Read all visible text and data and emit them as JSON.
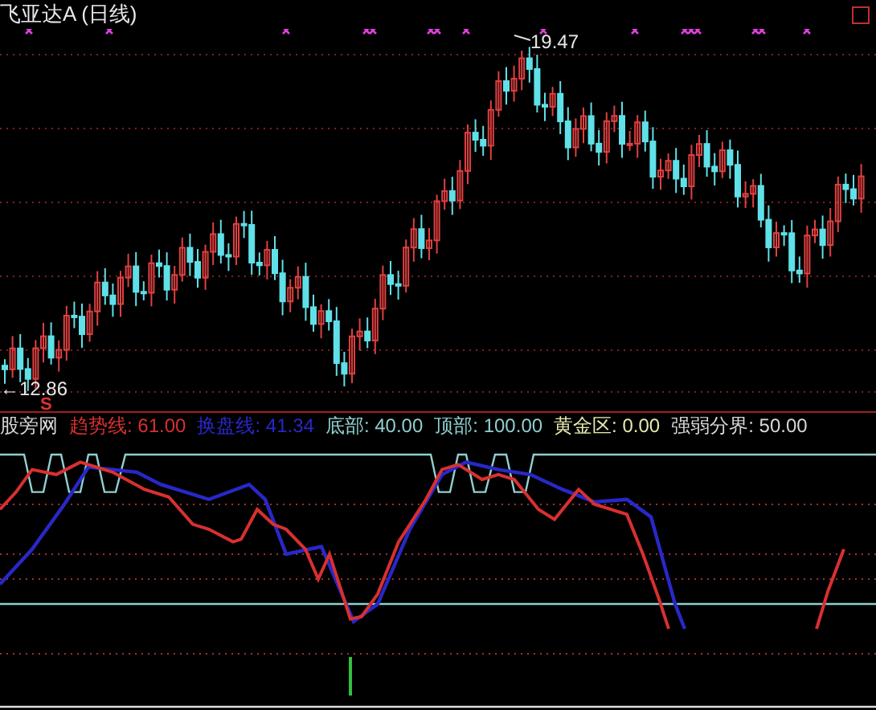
{
  "title": "飞亚达A (日线)",
  "price_chart": {
    "high_label": "19.47",
    "low_label": "←12.86",
    "signal": "S"
  },
  "legend": [
    {
      "label": "股旁网",
      "color": "#d8d8d8"
    },
    {
      "label": "趋势线:",
      "value": "61.00",
      "color": "#d83030"
    },
    {
      "label": "换盘线:",
      "value": "41.34",
      "color": "#2828c8"
    },
    {
      "label": "底部:",
      "value": "40.00",
      "color": "#90d0d0"
    },
    {
      "label": "顶部:",
      "value": "100.00",
      "color": "#90d0d0"
    },
    {
      "label": "黄金区:",
      "value": "0.00",
      "color": "#e8e8b0"
    },
    {
      "label": "强弱分界:",
      "value": "50.00",
      "color": "#d8d8d8"
    }
  ]
}
